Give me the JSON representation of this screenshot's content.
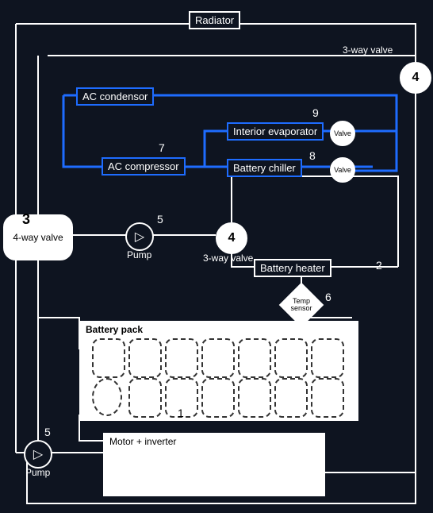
{
  "title": "Radiator",
  "threeway_top": "3-way valve",
  "ac_condensor": "AC condensor",
  "ac_compressor": "AC compressor",
  "interior_evap": "Interior evaporator",
  "battery_chiller": "Battery chiller",
  "valve1": "Valve",
  "valve2": "Valve",
  "four_way": "4-way valve",
  "pump_label_1": "Pump",
  "pump_label_2": "Pump",
  "threeway_mid": "3-way valve",
  "battery_heater": "Battery heater",
  "temp_sensor": "Temp sensor",
  "battery_pack": "Battery pack",
  "motor": "Motor + inverter",
  "n1": "1",
  "n2": "2",
  "n3": "3",
  "n4top": "4",
  "n4mid": "4",
  "n5a": "5",
  "n5b": "5",
  "n6": "6",
  "n7": "7",
  "n8": "8",
  "n9": "9"
}
